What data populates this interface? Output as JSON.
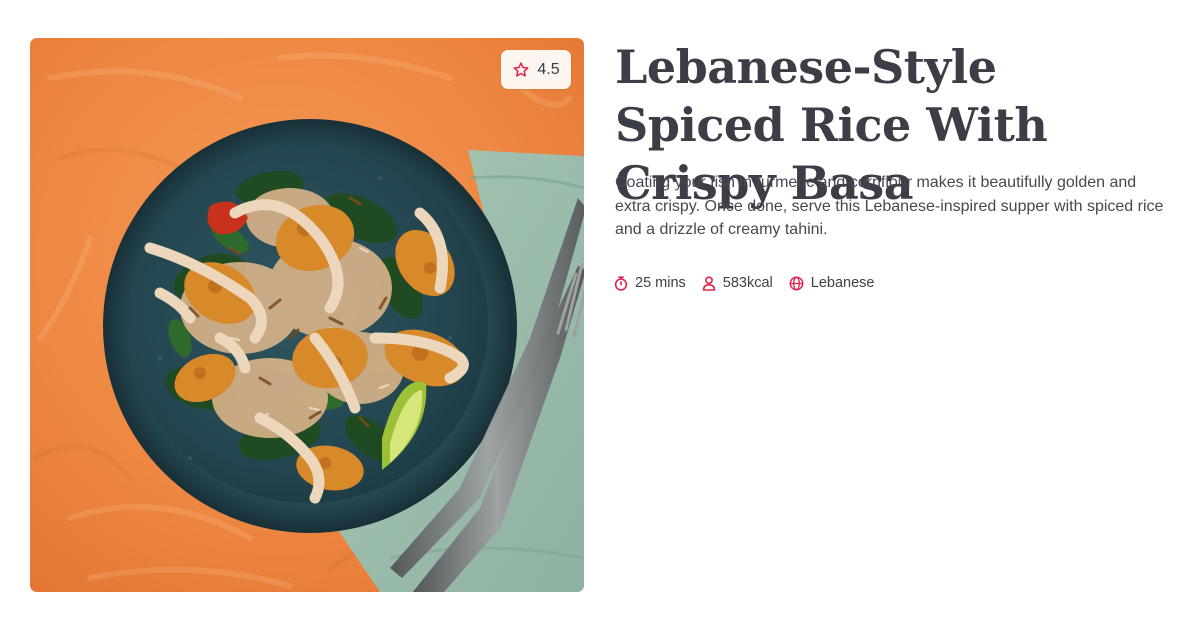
{
  "recipe": {
    "title": "Lebanese-Style Spiced Rice With Crispy Basa",
    "description": "Coating your fish in turmeric and cornflour makes it beautifully golden and extra crispy. Once done, serve this Lebanese-inspired supper with spiced rice and a drizzle of creamy tahini.",
    "rating": "4.5",
    "meta": {
      "time": "25 mins",
      "calories": "583kcal",
      "cuisine": "Lebanese"
    }
  },
  "icons": {
    "rating": "star-icon",
    "time": "stopwatch-icon",
    "calories": "person-icon",
    "cuisine": "globe-icon"
  },
  "colors": {
    "accent": "#e0234e",
    "background_orange": "#ef8a45",
    "plate": "#24454f",
    "napkin": "#9fbfae"
  }
}
